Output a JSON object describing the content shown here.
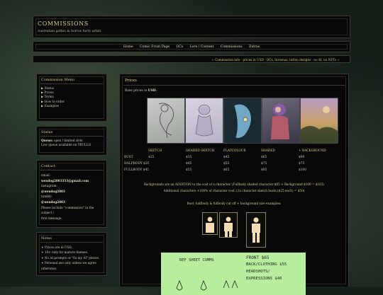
{
  "header": {
    "title": "COMMISSIONS",
    "subtitle": "Australian gothic & horror furry artist"
  },
  "nav": {
    "items": [
      "Home",
      "Comic Front Page",
      "OCs",
      "Lore / Content",
      "Commissions",
      "Extras"
    ]
  },
  "ticker": {
    "text": "☆ Commission info · prices in USD · OCs, fursonas, tattoo designs · no AI, no NFTs ☆"
  },
  "sidebar": {
    "menu": {
      "title": "Commission Menu",
      "items": [
        "▶ Status",
        "▶ Prices",
        "▶ Terms",
        "▶ How to order",
        "▶ Examples"
      ]
    },
    "status": {
      "title": "Status",
      "queue_label": "Queue:",
      "queue_value": "open / limited slots",
      "waitlist": "Low queue available on TBULLO"
    },
    "contact": {
      "title": "Contact",
      "email_label": "email:",
      "email": "wendog2003333@gmail.com",
      "instagram_label": "instagram:",
      "instagram": "@wendog2003",
      "tumblr_label": "tumblr:",
      "tumblr": "@wendog2003",
      "note1": "Please include \"commission\" in the subject /",
      "note2": "first message."
    },
    "notes": {
      "title": "Notes",
      "items": [
        "✦ Prices are in USD.",
        "✦ 18+ only for mature themes.",
        "✦ No AI prompts or \"fix my AI\" pieces.",
        "✦ Personal use only unless we agree",
        "otherwise."
      ]
    }
  },
  "prices": {
    "title": "Prices",
    "base_label": "Base prices in",
    "base_currency": "USD",
    "base_suffix": ":",
    "columns": [
      "SKETCH",
      "SHADED SKETCH",
      "FLATCOLOUR",
      "SHADED",
      "+ BACKGROUND"
    ],
    "rows": [
      {
        "label": "BUST",
        "values": [
          "$25",
          "$35",
          "$45",
          "$65",
          "$90"
        ]
      },
      {
        "label": "HALFBODY $35",
        "values": [
          "$45",
          "$55",
          "$75",
          "$75"
        ]
      },
      {
        "label": "FULLBODY $45",
        "values": [
          "$55",
          "$65",
          "$85",
          "$100"
        ]
      }
    ],
    "note_bg": "Backgrounds are an ADDITION to the cost of a character. (Fullbody shaded character $65 + Background $100 = $165)",
    "note_chars": "Additional characters +100% of character cost. (2x character sketch busts ($25 each) = $50)",
    "note_crop": "Bust, halfbody & fullbody cut off + background size examples:"
  },
  "reference_sheet": {
    "line1": "REF SHEET COMMS",
    "line2": "FRONT $65",
    "line3": "BACK/CLOTHING $55",
    "line4": "HEADSHOTS/",
    "line5": "EXPRESSIONS $40"
  }
}
